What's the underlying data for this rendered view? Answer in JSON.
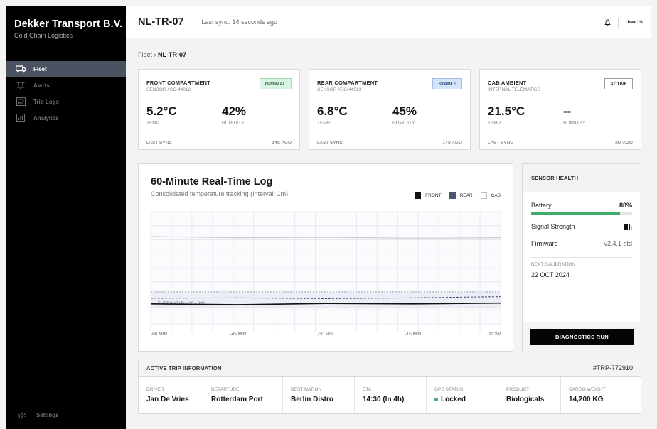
{
  "sidebar": {
    "brand_title": "Dekker Transport B.V.",
    "brand_sub": "Cold Chain Logistics",
    "items": [
      {
        "label": "Fleet",
        "icon": "truck-icon",
        "active": true
      },
      {
        "label": "Alerts",
        "icon": "alert-icon",
        "active": false
      },
      {
        "label": "Trip Logs",
        "icon": "route-icon",
        "active": false
      },
      {
        "label": "Analytics",
        "icon": "chart-icon",
        "active": false
      }
    ],
    "settings_label": "Settings"
  },
  "header": {
    "unit_id": "NL-TR-07",
    "sync_text": "Last sync: 14 seconds ago",
    "user_label": "User JS"
  },
  "breadcrumb": {
    "parent": "Fleet",
    "separator": "›",
    "current": "NL-TR-07"
  },
  "cards": [
    {
      "title": "FRONT COMPARTMENT",
      "sensor": "SENSOR #SC-44012",
      "badge": "OPTIMAL",
      "badge_style": "optimal",
      "temp": "5.2°C",
      "temp_label": "TEMP",
      "humidity": "42%",
      "humidity_label": "HUMIDITY",
      "sync_label": "LAST SYNC",
      "sync_value": "14S AGO"
    },
    {
      "title": "REAR COMPARTMENT",
      "sensor": "SENSOR #SC-44013",
      "badge": "STABLE",
      "badge_style": "stable",
      "temp": "6.8°C",
      "temp_label": "TEMP",
      "humidity": "45%",
      "humidity_label": "HUMIDITY",
      "sync_label": "LAST SYNC",
      "sync_value": "14S AGO"
    },
    {
      "title": "CAB AMBIENT",
      "sensor": "INTERNAL TELEMATICS",
      "badge": "ACTIVE",
      "badge_style": "active",
      "temp": "21.5°C",
      "temp_label": "TEMP",
      "humidity": "--",
      "humidity_label": "HUMIDITY",
      "sync_label": "LAST SYNC",
      "sync_value": "2M AGO"
    }
  ],
  "chart_panel": {
    "title": "60-Minute Real-Time Log",
    "subtitle": "Consolidated temperature tracking (Interval: 1m)",
    "threshold_label": "THRESHOLD: 4°C - 8°C"
  },
  "chart_data": {
    "type": "line",
    "x": [
      "-60 MIN",
      "-45 MIN",
      "-30 MIN",
      "-15 MIN",
      "NOW"
    ],
    "xlabels": [
      "-60 MIN",
      "-45 MIN",
      "-30 MIN",
      "-15 MIN",
      "NOW"
    ],
    "series": [
      {
        "name": "FRONT",
        "color": "#111111",
        "style": "solid",
        "values": [
          5.0,
          4.8,
          5.1,
          5.0,
          5.2
        ]
      },
      {
        "name": "REAR",
        "color": "#4a5570",
        "style": "dashed",
        "values": [
          6.4,
          6.5,
          6.3,
          6.5,
          6.8
        ]
      },
      {
        "name": "CAB",
        "color": "#c8c8c8",
        "style": "solid",
        "values": [
          21.8,
          21.5,
          21.6,
          21.4,
          21.5
        ]
      }
    ],
    "threshold": [
      4,
      8
    ],
    "ylim": [
      0,
      28
    ],
    "grid": true,
    "legend": "top-right"
  },
  "health": {
    "title": "SENSOR HEALTH",
    "battery_label": "Battery",
    "battery_value": "88%",
    "battery_level": 0.88,
    "signal_label": "Signal Strength",
    "signal_icon": "signal-bars-icon",
    "signal_level": 3,
    "firmware_label": "Firmware",
    "firmware_value": "v2.4.1-std",
    "calibration_label": "NEXT CALIBRATION",
    "calibration_value": "22 OCT 2024",
    "button_label": "DIAGNOSTICS RUN"
  },
  "trip": {
    "title": "ACTIVE TRIP INFORMATION",
    "trip_id": "#TRP-772910",
    "fields": [
      {
        "label": "DRIVER",
        "value": "Jan De Vries"
      },
      {
        "label": "DEPARTURE",
        "value": "Rotterdam Port"
      },
      {
        "label": "DESTINATION",
        "value": "Berlin Distro"
      },
      {
        "label": "ETA",
        "value": "14:30 (In 4h)"
      },
      {
        "label": "GPS STATUS",
        "value": "Locked"
      },
      {
        "label": "PRODUCT",
        "value": "Biologicals"
      },
      {
        "label": "CARGO WEIGHT",
        "value": "14,200 KG"
      }
    ]
  },
  "colors": {
    "sidebar_bg": "#000000",
    "active_nav": "#4a5160",
    "optimal": "#d9f4e3",
    "stable": "#d5e4fb",
    "battery": "#3fae6c",
    "gps_ok": "#3fae6c"
  }
}
